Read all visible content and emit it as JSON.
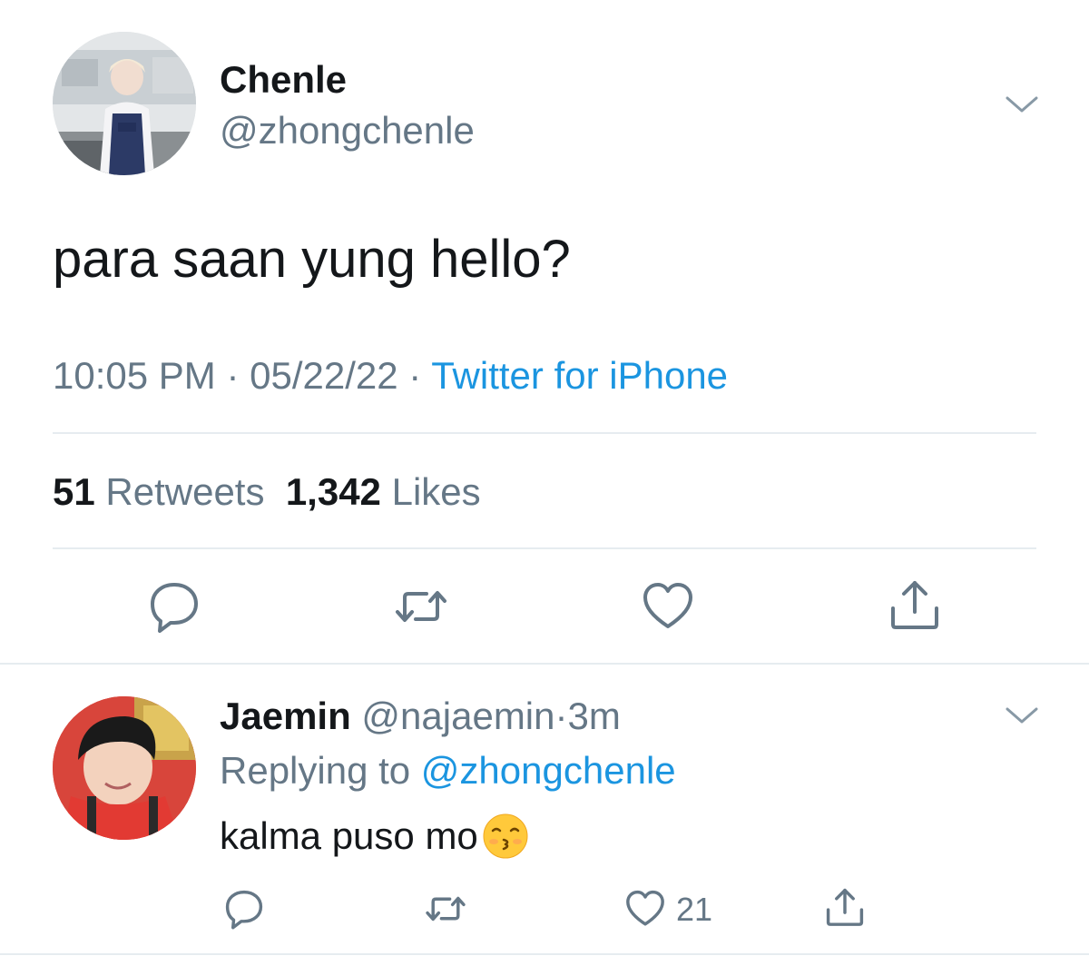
{
  "main_tweet": {
    "display_name": "Chenle",
    "handle": "@zhongchenle",
    "text": "para saan yung hello?",
    "time": "10:05 PM",
    "separator": "·",
    "date": "05/22/22",
    "source": "Twitter for iPhone",
    "retweet_count": "51",
    "retweet_label": "Retweets",
    "like_count": "1,342",
    "like_label": "Likes"
  },
  "reply_tweet": {
    "display_name": "Jaemin",
    "handle": "@najaemin",
    "separator": "·",
    "age": "3m",
    "replying_prefix": "Replying to",
    "replying_to": "@zhongchenle",
    "text": "kalma puso mo",
    "emoji": "kissing-face-with-closed-eyes",
    "like_count": "21"
  },
  "colors": {
    "primary_text": "#14171a",
    "secondary_text": "#657786",
    "link": "#1b95e0",
    "divider": "#e6ecf0"
  },
  "icons": {
    "reply": "reply-icon",
    "retweet": "retweet-icon",
    "like": "heart-icon",
    "share": "share-icon",
    "menu": "chevron-down-icon"
  }
}
